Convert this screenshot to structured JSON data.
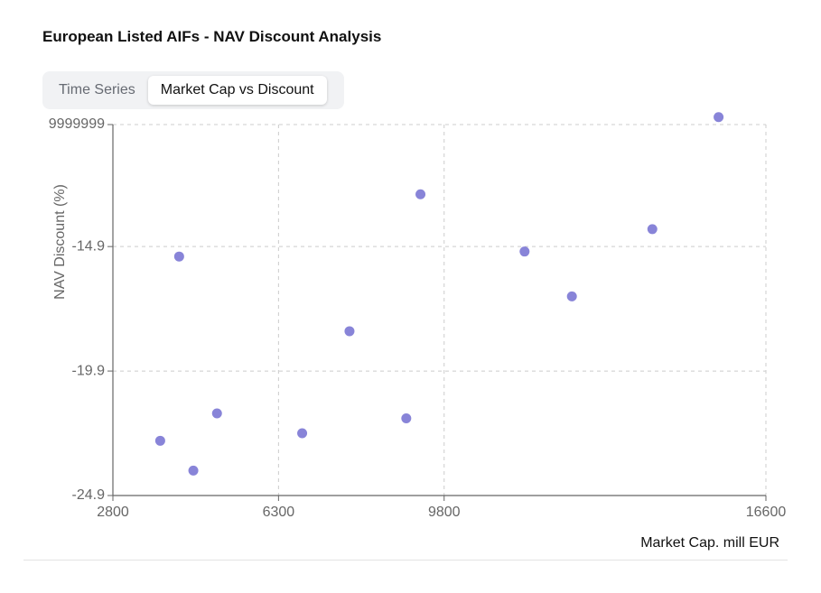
{
  "page": {
    "title": "European Listed AIFs - NAV Discount Analysis"
  },
  "tabs": [
    {
      "label": "Time Series",
      "active": false
    },
    {
      "label": "Market Cap vs Discount",
      "active": true
    }
  ],
  "chart_data": {
    "type": "scatter",
    "title": "",
    "xlabel": "Market Cap. mill EUR",
    "ylabel": "NAV Discount (%)",
    "xlim": [
      2800,
      16600
    ],
    "ylim": [
      -24.9,
      -9.9999999
    ],
    "x_ticks": [
      "2800",
      "6300",
      "9800",
      "16600"
    ],
    "x_tick_values": [
      2800,
      6300,
      9800,
      16600
    ],
    "y_ticks": [
      "-24.9",
      "-19.9",
      "-14.9",
      "9999999"
    ],
    "y_tick_values": [
      -24.9,
      -19.9,
      -14.9,
      -9.9999999
    ],
    "grid": true,
    "point_color": "#8884d8",
    "points": [
      {
        "x": 3800,
        "y": -22.7
      },
      {
        "x": 4200,
        "y": -15.3
      },
      {
        "x": 4500,
        "y": -23.9
      },
      {
        "x": 5000,
        "y": -21.6
      },
      {
        "x": 6800,
        "y": -22.4
      },
      {
        "x": 7800,
        "y": -18.3
      },
      {
        "x": 9000,
        "y": -21.8
      },
      {
        "x": 9300,
        "y": -12.8
      },
      {
        "x": 11500,
        "y": -15.1
      },
      {
        "x": 12500,
        "y": -16.9
      },
      {
        "x": 14200,
        "y": -14.2
      },
      {
        "x": 15600,
        "y": -9.7
      }
    ]
  }
}
